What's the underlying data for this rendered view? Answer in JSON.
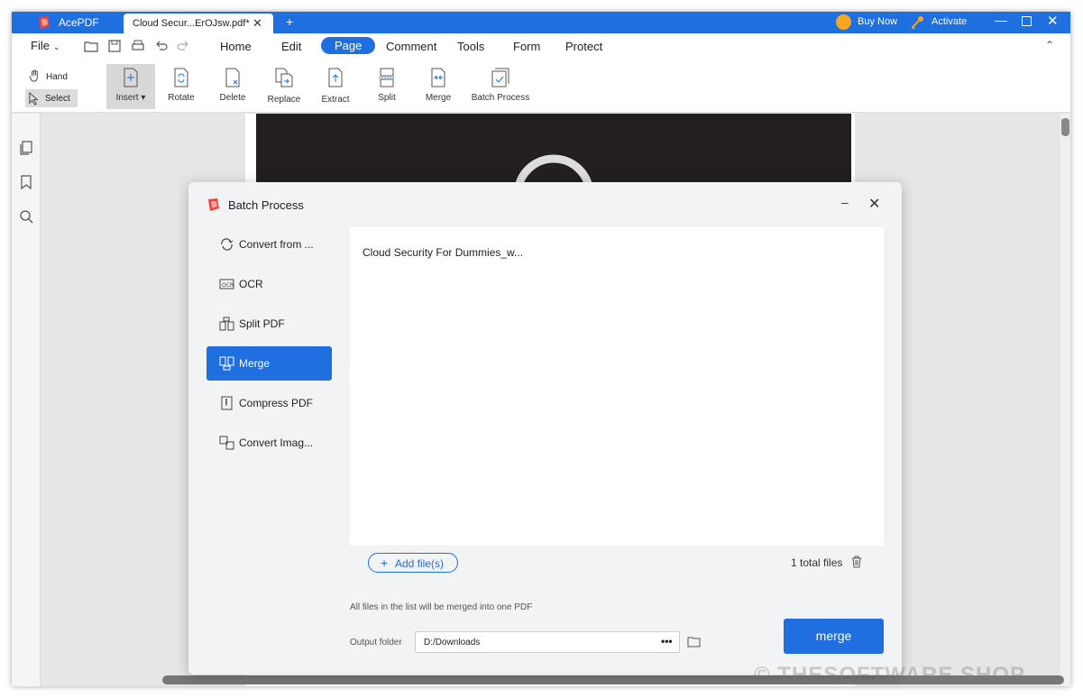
{
  "app": {
    "name": "AcePDF",
    "tab_title": "Cloud Secur...ErOJsw.pdf*",
    "buy_now": "Buy Now",
    "activate": "Activate"
  },
  "menu": {
    "file": "File",
    "items": [
      "Home",
      "Edit",
      "Page",
      "Comment",
      "Tools",
      "Form",
      "Protect"
    ],
    "active": "Page"
  },
  "ribbon": {
    "hand": "Hand",
    "select": "Select",
    "buttons": [
      "Insert",
      "Rotate",
      "Delete",
      "Replace",
      "Extract",
      "Split",
      "Merge",
      "Batch Process"
    ]
  },
  "dialog": {
    "title": "Batch Process",
    "sidebar": [
      "Convert from ...",
      "OCR",
      "Split PDF",
      "Merge",
      "Compress PDF",
      "Convert Imag..."
    ],
    "active_item": "Merge",
    "files": [
      "Cloud Security For Dummies_w..."
    ],
    "add_files": "Add file(s)",
    "total_files": "1 total files",
    "note": "All files in the list will be merged into one PDF",
    "output_label": "Output folder",
    "output_value": "D:/Downloads",
    "more": "•••",
    "merge_button": "merge"
  },
  "watermark": "© THESOFTWARE.SHOP",
  "colors": {
    "accent": "#1f6fe0",
    "cover": "#231f20"
  }
}
